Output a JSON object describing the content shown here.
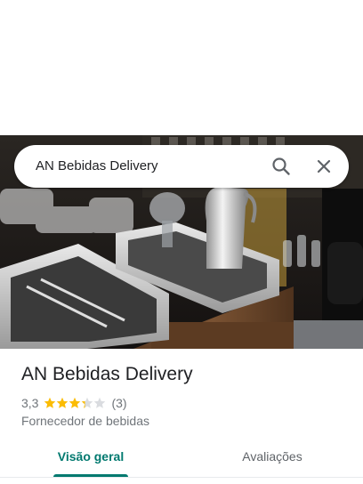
{
  "search": {
    "query": "AN Bebidas Delivery"
  },
  "place": {
    "title": "AN Bebidas Delivery",
    "rating_value": "3,3",
    "rating_stars": 3.3,
    "review_count": "(3)",
    "category": "Fornecedor de bebidas"
  },
  "tabs": [
    {
      "label": "Visão geral",
      "active": true
    },
    {
      "label": "Avaliações",
      "active": false
    }
  ],
  "colors": {
    "accent": "#01796f",
    "star": "#fbbc04",
    "star_empty": "#dadce0"
  },
  "icons": [
    "search-icon",
    "close-icon",
    "star-icon"
  ]
}
